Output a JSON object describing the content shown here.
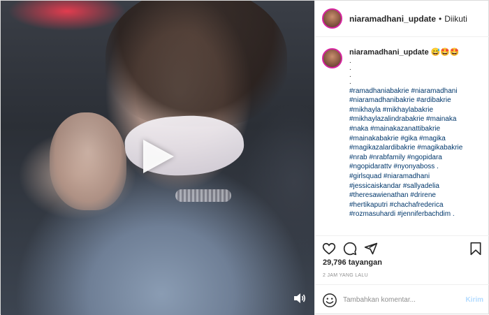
{
  "header": {
    "username": "niaramadhani_update",
    "dot": "•",
    "follow_status": "Diikuti"
  },
  "caption": {
    "username": "niaramadhani_update",
    "emoji": "😅🤩🤩",
    "dots": [
      ".",
      ".",
      ".",
      "."
    ],
    "hashtags": [
      "#ramadhaniabakrie #niaramadhani",
      "#niaramadhanibakrie #ardibakrie",
      "#mikhayla #mikhaylabakrie",
      "#mikhaylazalindrabakrie #mainaka",
      "#naka #mainakazanattibakrie",
      "#mainakabakrie #gika #magika",
      "#magikazalardibakrie #magikabakrie",
      "#nrab #nrabfamily #ngopidara",
      "#ngopidarattv #nyonyaboss .",
      "#girlsquad #niaramadhani",
      "#jessicaiskandar #sallyadelia",
      "#theresawienathan #drirene",
      "#hertikaputri #chachafrederica",
      "#rozmasuhardi #jenniferbachdim ."
    ]
  },
  "stats": {
    "views": "29,796 tayangan",
    "time": "2 JAM YANG LALU"
  },
  "comment": {
    "placeholder": "Tambahkan komentar...",
    "post_label": "Kirim"
  },
  "icons": {
    "like": "heart-icon",
    "comment": "comment-icon",
    "share": "share-icon",
    "save": "bookmark-icon",
    "play": "play-icon",
    "sound": "speaker-icon",
    "emoji": "smiley-icon"
  },
  "colors": {
    "hashtag": "#00376b",
    "post_button_disabled": "#b3dbff",
    "muted_text": "#8e8e8e",
    "border": "#dbdbdb"
  }
}
